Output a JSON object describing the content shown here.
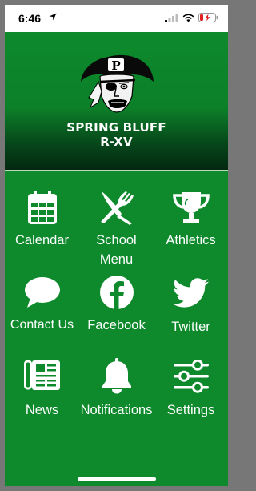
{
  "status_bar": {
    "time": "6:46"
  },
  "header": {
    "school_name_line1": "SPRING BLUFF",
    "school_name_line2": "R-XV",
    "logo_letter": "P"
  },
  "menu": {
    "calendar": "Calendar",
    "school_menu_line1": "School",
    "school_menu_line2": "Menu",
    "athletics": "Athletics",
    "contact_us": "Contact Us",
    "facebook": "Facebook",
    "twitter": "Twitter",
    "news": "News",
    "notifications": "Notifications",
    "settings": "Settings"
  },
  "colors": {
    "brand_green": "#0e8a2d",
    "header_dark": "#032810",
    "icon": "#ffffff",
    "battery_low": "#e02020"
  }
}
